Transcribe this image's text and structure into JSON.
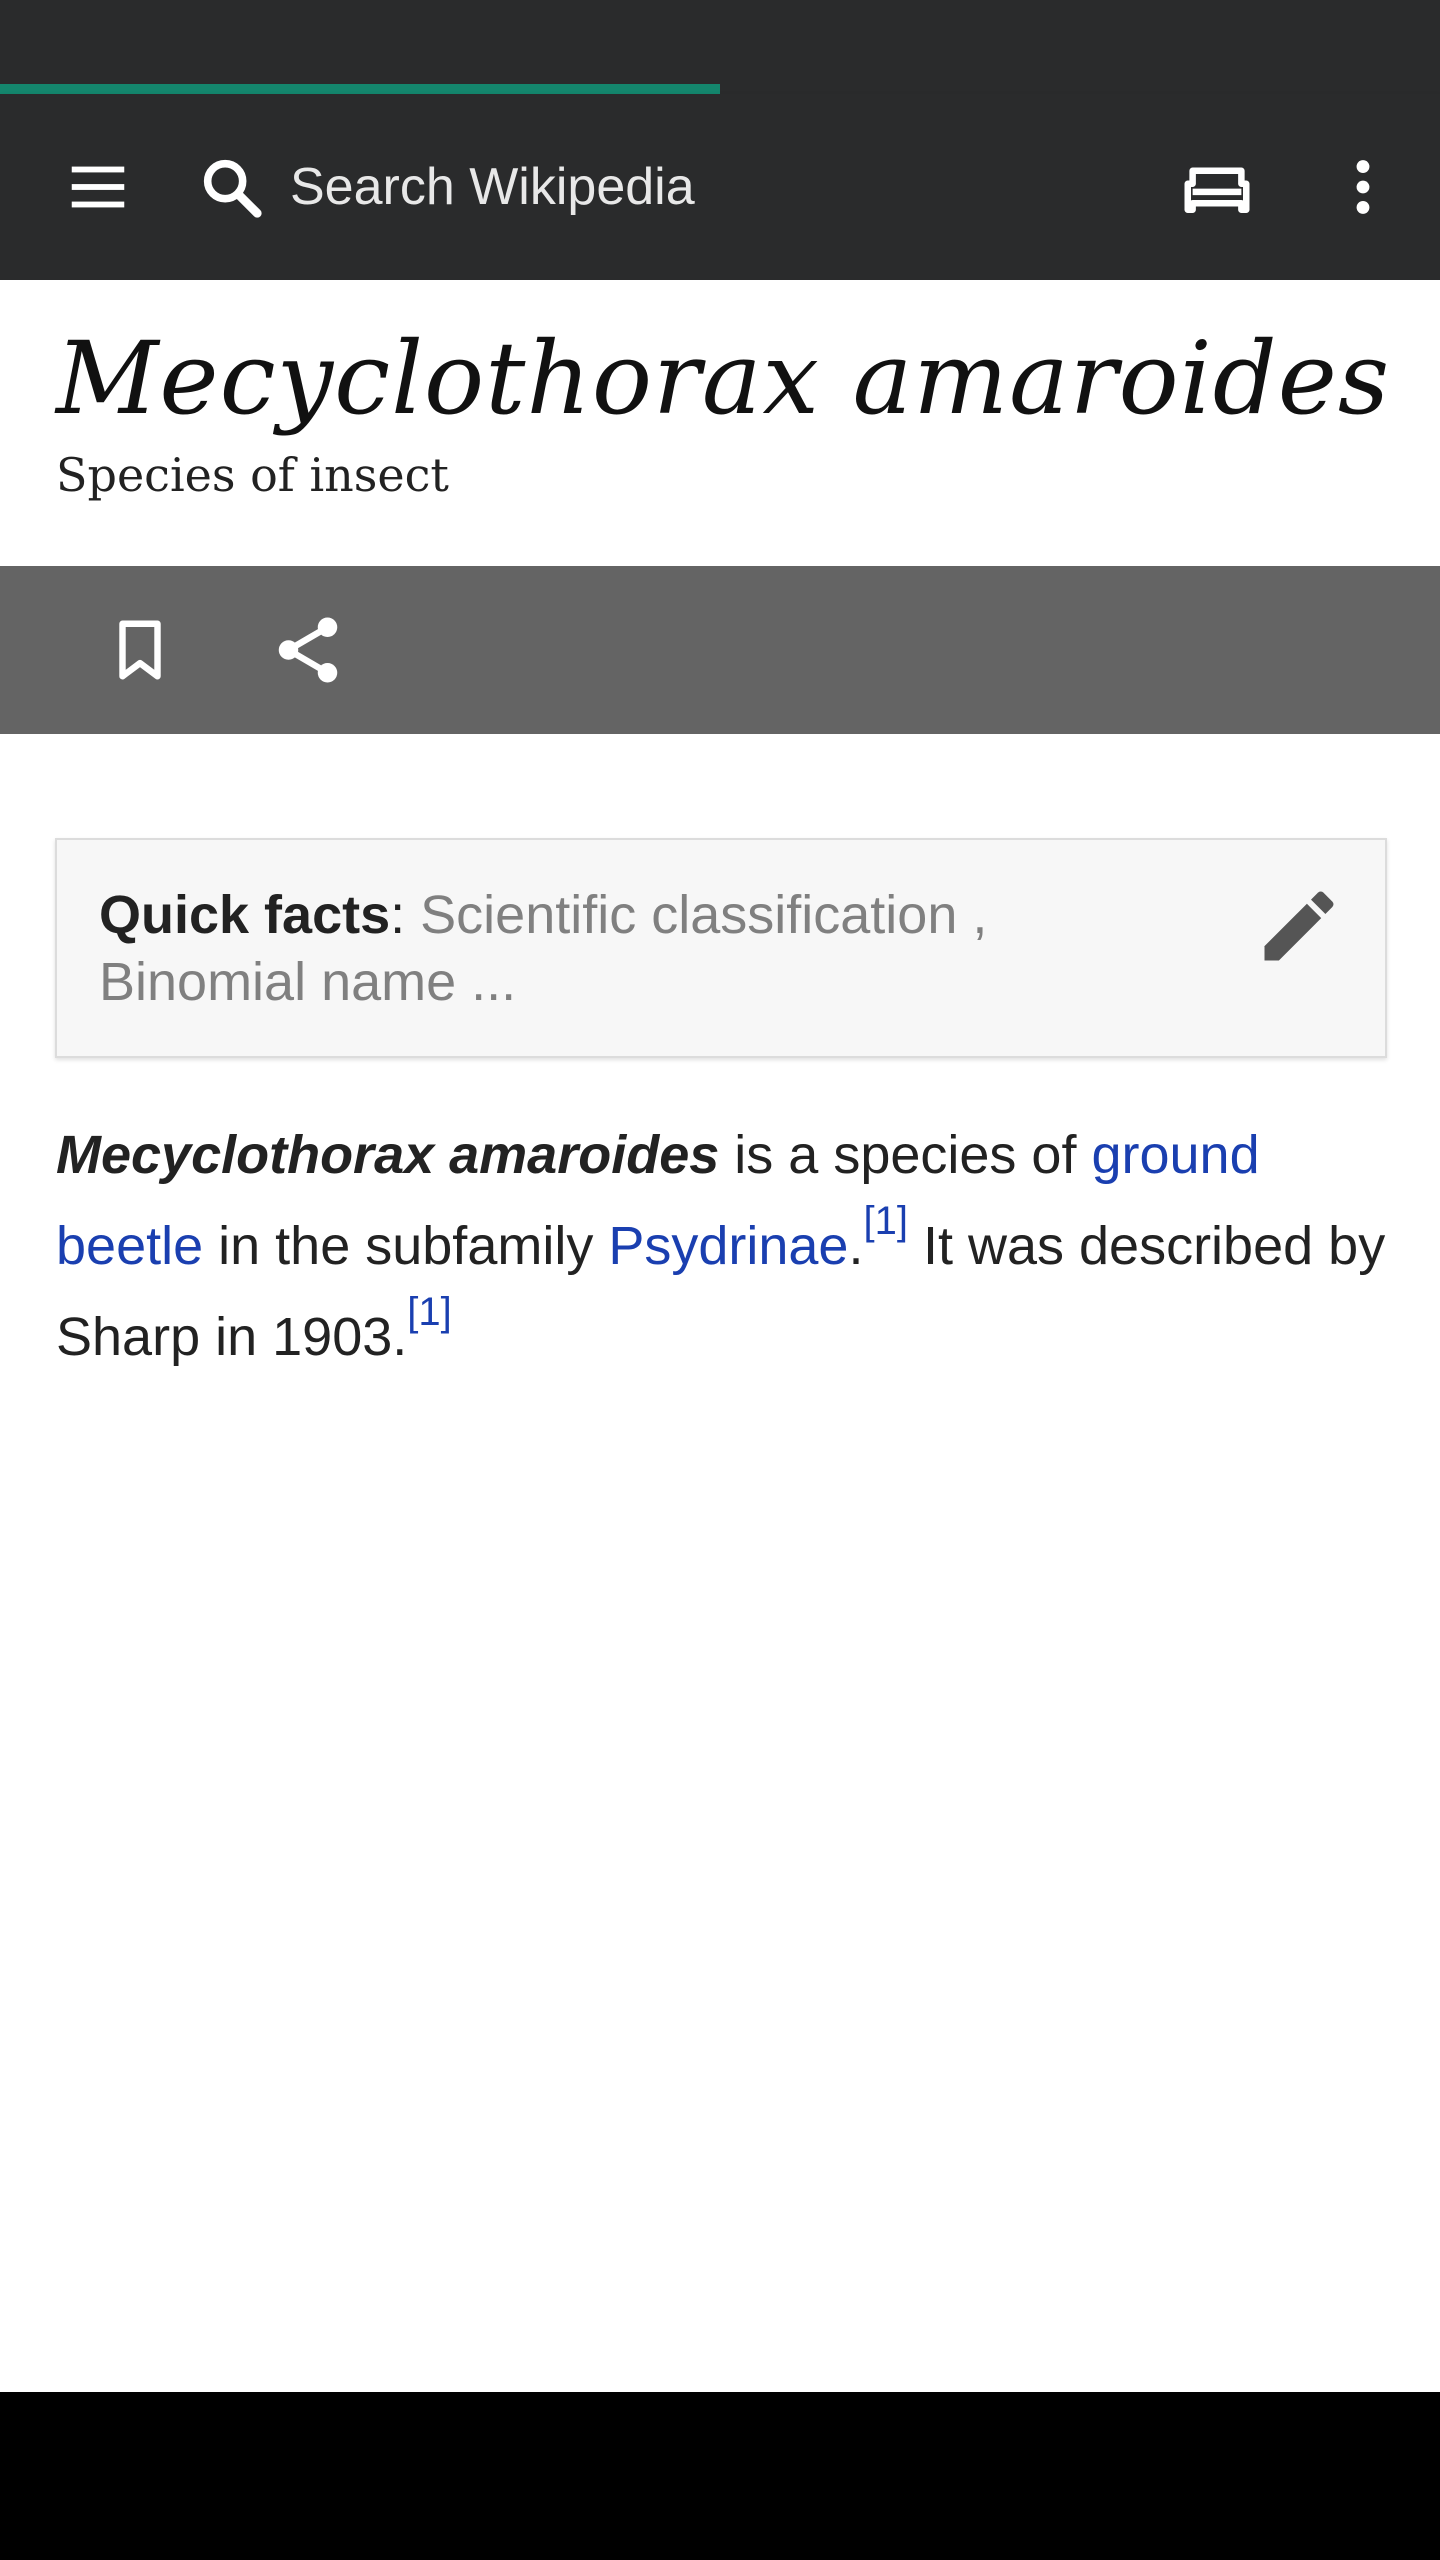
{
  "colors": {
    "toolbar_bg": "#2a2b2c",
    "progress": "#14866d",
    "action_bar_bg": "#646464",
    "link": "#1a3fb0",
    "text": "#222222"
  },
  "progress": {
    "fraction": 0.5
  },
  "toolbar": {
    "menu_icon": "hamburger-menu-icon",
    "search_icon": "search-icon",
    "search_placeholder": "Search Wikipedia",
    "tabs_icon": "tabs-icon",
    "overflow_icon": "more-vertical-icon"
  },
  "article": {
    "title": "Mecyclothorax amaroides",
    "description": "Species of insect"
  },
  "actions": {
    "bookmark_icon": "bookmark-icon",
    "share_icon": "share-icon"
  },
  "quick_facts": {
    "label": "Quick facts",
    "separator": ":",
    "summary": " Scientific classification , Binomial name ...",
    "edit_icon": "edit-pencil-icon"
  },
  "body": {
    "subject": "Mecyclothorax amaroides",
    "text1": " is a species of ",
    "link1": "ground beetle",
    "text2": " in the subfamily ",
    "link2": "Psydrinae",
    "text3": ".",
    "ref1": "[1]",
    "text4": " It was described by Sharp in 1903.",
    "ref2": "[1]"
  }
}
